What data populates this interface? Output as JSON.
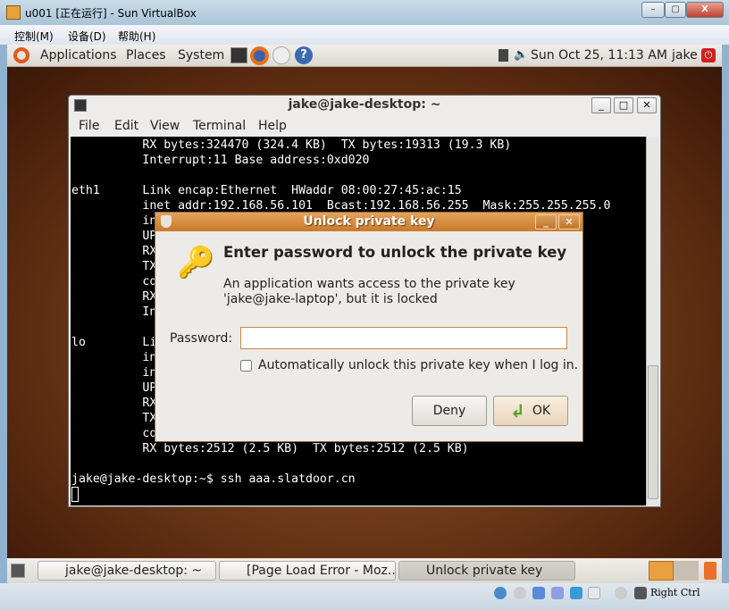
{
  "vbox": {
    "title": "u001 [正在运行] - Sun VirtualBox",
    "menu": [
      "控制(M)",
      "设备(D)",
      "帮助(H)"
    ],
    "min": "–",
    "max": "▢",
    "close": "X",
    "host_key": "Right Ctrl"
  },
  "top_panel": {
    "menus": [
      "Applications",
      "Places",
      "System"
    ],
    "clock": "Sun Oct 25, 11:13 AM",
    "user": "jake"
  },
  "terminal": {
    "title": "jake@jake-desktop: ~",
    "menu": [
      "File",
      "Edit",
      "View",
      "Terminal",
      "Help"
    ],
    "lines": [
      "          RX bytes:324470 (324.4 KB)  TX bytes:19313 (19.3 KB)",
      "          Interrupt:11 Base address:0xd020",
      "",
      "eth1      Link encap:Ethernet  HWaddr 08:00:27:45:ac:15",
      "          inet addr:192.168.56.101  Bcast:192.168.56.255  Mask:255.255.255.0",
      "          in",
      "          UP",
      "          RX",
      "          TX",
      "          co",
      "          RX",
      "          In",
      "",
      "lo        Li",
      "          in",
      "          in",
      "          UP",
      "          RX",
      "          TX",
      "          co",
      "          RX bytes:2512 (2.5 KB)  TX bytes:2512 (2.5 KB)",
      "",
      "jake@jake-desktop:~$ ssh aaa.slatdoor.cn"
    ]
  },
  "dialog": {
    "title": "Unlock private key",
    "heading": "Enter password to unlock the private key",
    "message": "An application wants access to the private key 'jake@jake-laptop', but it is locked",
    "password_label": "Password:",
    "password_value": "",
    "checkbox_label": "Automatically unlock this private key when I log in.",
    "checkbox_checked": false,
    "deny": "Deny",
    "ok": "OK"
  },
  "taskbar": {
    "items": [
      "jake@jake-desktop: ~",
      "[Page Load Error - Moz...",
      "Unlock private key"
    ]
  },
  "colors": {
    "dialog_title": "#d98a3a",
    "desktop": "#6a3418",
    "terminal_bg": "#000000"
  }
}
